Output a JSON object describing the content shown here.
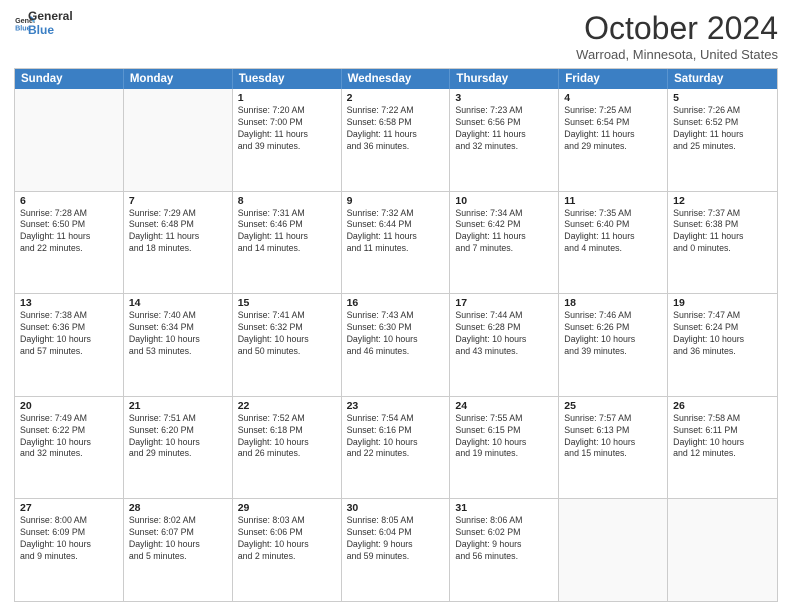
{
  "header": {
    "logo_line1": "General",
    "logo_line2": "Blue",
    "month_title": "October 2024",
    "subtitle": "Warroad, Minnesota, United States"
  },
  "weekdays": [
    "Sunday",
    "Monday",
    "Tuesday",
    "Wednesday",
    "Thursday",
    "Friday",
    "Saturday"
  ],
  "rows": [
    [
      {
        "day": "",
        "text": ""
      },
      {
        "day": "",
        "text": ""
      },
      {
        "day": "1",
        "text": "Sunrise: 7:20 AM\nSunset: 7:00 PM\nDaylight: 11 hours\nand 39 minutes."
      },
      {
        "day": "2",
        "text": "Sunrise: 7:22 AM\nSunset: 6:58 PM\nDaylight: 11 hours\nand 36 minutes."
      },
      {
        "day": "3",
        "text": "Sunrise: 7:23 AM\nSunset: 6:56 PM\nDaylight: 11 hours\nand 32 minutes."
      },
      {
        "day": "4",
        "text": "Sunrise: 7:25 AM\nSunset: 6:54 PM\nDaylight: 11 hours\nand 29 minutes."
      },
      {
        "day": "5",
        "text": "Sunrise: 7:26 AM\nSunset: 6:52 PM\nDaylight: 11 hours\nand 25 minutes."
      }
    ],
    [
      {
        "day": "6",
        "text": "Sunrise: 7:28 AM\nSunset: 6:50 PM\nDaylight: 11 hours\nand 22 minutes."
      },
      {
        "day": "7",
        "text": "Sunrise: 7:29 AM\nSunset: 6:48 PM\nDaylight: 11 hours\nand 18 minutes."
      },
      {
        "day": "8",
        "text": "Sunrise: 7:31 AM\nSunset: 6:46 PM\nDaylight: 11 hours\nand 14 minutes."
      },
      {
        "day": "9",
        "text": "Sunrise: 7:32 AM\nSunset: 6:44 PM\nDaylight: 11 hours\nand 11 minutes."
      },
      {
        "day": "10",
        "text": "Sunrise: 7:34 AM\nSunset: 6:42 PM\nDaylight: 11 hours\nand 7 minutes."
      },
      {
        "day": "11",
        "text": "Sunrise: 7:35 AM\nSunset: 6:40 PM\nDaylight: 11 hours\nand 4 minutes."
      },
      {
        "day": "12",
        "text": "Sunrise: 7:37 AM\nSunset: 6:38 PM\nDaylight: 11 hours\nand 0 minutes."
      }
    ],
    [
      {
        "day": "13",
        "text": "Sunrise: 7:38 AM\nSunset: 6:36 PM\nDaylight: 10 hours\nand 57 minutes."
      },
      {
        "day": "14",
        "text": "Sunrise: 7:40 AM\nSunset: 6:34 PM\nDaylight: 10 hours\nand 53 minutes."
      },
      {
        "day": "15",
        "text": "Sunrise: 7:41 AM\nSunset: 6:32 PM\nDaylight: 10 hours\nand 50 minutes."
      },
      {
        "day": "16",
        "text": "Sunrise: 7:43 AM\nSunset: 6:30 PM\nDaylight: 10 hours\nand 46 minutes."
      },
      {
        "day": "17",
        "text": "Sunrise: 7:44 AM\nSunset: 6:28 PM\nDaylight: 10 hours\nand 43 minutes."
      },
      {
        "day": "18",
        "text": "Sunrise: 7:46 AM\nSunset: 6:26 PM\nDaylight: 10 hours\nand 39 minutes."
      },
      {
        "day": "19",
        "text": "Sunrise: 7:47 AM\nSunset: 6:24 PM\nDaylight: 10 hours\nand 36 minutes."
      }
    ],
    [
      {
        "day": "20",
        "text": "Sunrise: 7:49 AM\nSunset: 6:22 PM\nDaylight: 10 hours\nand 32 minutes."
      },
      {
        "day": "21",
        "text": "Sunrise: 7:51 AM\nSunset: 6:20 PM\nDaylight: 10 hours\nand 29 minutes."
      },
      {
        "day": "22",
        "text": "Sunrise: 7:52 AM\nSunset: 6:18 PM\nDaylight: 10 hours\nand 26 minutes."
      },
      {
        "day": "23",
        "text": "Sunrise: 7:54 AM\nSunset: 6:16 PM\nDaylight: 10 hours\nand 22 minutes."
      },
      {
        "day": "24",
        "text": "Sunrise: 7:55 AM\nSunset: 6:15 PM\nDaylight: 10 hours\nand 19 minutes."
      },
      {
        "day": "25",
        "text": "Sunrise: 7:57 AM\nSunset: 6:13 PM\nDaylight: 10 hours\nand 15 minutes."
      },
      {
        "day": "26",
        "text": "Sunrise: 7:58 AM\nSunset: 6:11 PM\nDaylight: 10 hours\nand 12 minutes."
      }
    ],
    [
      {
        "day": "27",
        "text": "Sunrise: 8:00 AM\nSunset: 6:09 PM\nDaylight: 10 hours\nand 9 minutes."
      },
      {
        "day": "28",
        "text": "Sunrise: 8:02 AM\nSunset: 6:07 PM\nDaylight: 10 hours\nand 5 minutes."
      },
      {
        "day": "29",
        "text": "Sunrise: 8:03 AM\nSunset: 6:06 PM\nDaylight: 10 hours\nand 2 minutes."
      },
      {
        "day": "30",
        "text": "Sunrise: 8:05 AM\nSunset: 6:04 PM\nDaylight: 9 hours\nand 59 minutes."
      },
      {
        "day": "31",
        "text": "Sunrise: 8:06 AM\nSunset: 6:02 PM\nDaylight: 9 hours\nand 56 minutes."
      },
      {
        "day": "",
        "text": ""
      },
      {
        "day": "",
        "text": ""
      }
    ]
  ]
}
